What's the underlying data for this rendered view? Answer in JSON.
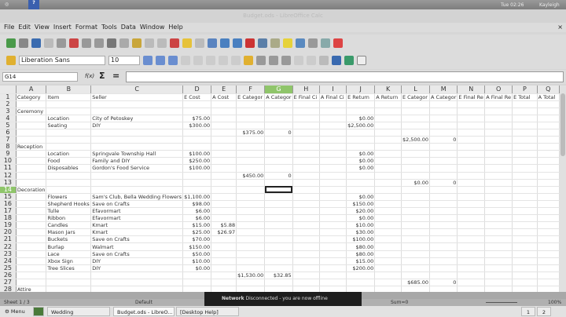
{
  "top_panel": {
    "clock": "Tue 02:26",
    "user": "Kayleigh"
  },
  "window": {
    "title": "Budget.ods - LibreOffice Calc"
  },
  "menu": [
    "File",
    "Edit",
    "View",
    "Insert",
    "Format",
    "Tools",
    "Data",
    "Window",
    "Help"
  ],
  "format_bar": {
    "font_name": "Liberation Sans",
    "font_size": "10"
  },
  "formula_bar": {
    "cell_ref": "G14",
    "fx": "f(x)",
    "sigma": "Σ",
    "equals": "=",
    "value": ""
  },
  "columns": [
    "A",
    "B",
    "C",
    "D",
    "E",
    "F",
    "G",
    "H",
    "I",
    "J",
    "K",
    "L",
    "M",
    "N",
    "O",
    "P",
    "Q"
  ],
  "selected_cell": "G14",
  "rows": [
    [
      "Category",
      "Item",
      "Seller",
      "E Cost",
      "A Cost",
      "E Categor",
      "A Categor",
      "E Final Ci",
      "A Final Ci",
      "E Return",
      "A Return",
      "E Categor",
      "A Categor",
      "E Final Re",
      "A Final Re",
      "E Total",
      "A Total"
    ],
    [],
    [
      "Ceremony"
    ],
    [
      "",
      "Location",
      "City of Petoskey",
      "$75.00",
      "",
      "",
      "",
      "",
      "",
      "$0.00"
    ],
    [
      "",
      "Seating",
      "DIY",
      "$300.00",
      "",
      "",
      "",
      "",
      "",
      "$2,500.00"
    ],
    [
      "",
      "",
      "",
      "",
      "",
      "$375.00",
      "0"
    ],
    [
      "",
      "",
      "",
      "",
      "",
      "",
      "",
      "",
      "",
      "",
      "",
      "$2,500.00",
      "0"
    ],
    [
      "Reception"
    ],
    [
      "",
      "Location",
      "Springvale Township Hall",
      "$100.00",
      "",
      "",
      "",
      "",
      "",
      "$0.00"
    ],
    [
      "",
      "Food",
      "Family and DIY",
      "$250.00",
      "",
      "",
      "",
      "",
      "",
      "$0.00"
    ],
    [
      "",
      "Disposables",
      "Gordon's Food Service",
      "$100.00",
      "",
      "",
      "",
      "",
      "",
      "$0.00"
    ],
    [
      "",
      "",
      "",
      "",
      "",
      "$450.00",
      "0"
    ],
    [
      "",
      "",
      "",
      "",
      "",
      "",
      "",
      "",
      "",
      "",
      "",
      "$0.00",
      "0"
    ],
    [
      "Decoration"
    ],
    [
      "",
      "Flowers",
      "Sam's Club, Bella Wedding Flowers",
      "$1,100.00",
      "",
      "",
      "",
      "",
      "",
      "$0.00"
    ],
    [
      "",
      "Shepherd Hooks",
      "Save on Crafts",
      "$98.00",
      "",
      "",
      "",
      "",
      "",
      "$150.00"
    ],
    [
      "",
      "Tulle",
      "Efavormart",
      "$6.00",
      "",
      "",
      "",
      "",
      "",
      "$20.00"
    ],
    [
      "",
      "Ribbon",
      "Efavormart",
      "$6.00",
      "",
      "",
      "",
      "",
      "",
      "$0.00"
    ],
    [
      "",
      "Candles",
      "Kmart",
      "$15.00",
      "$5.88",
      "",
      "",
      "",
      "",
      "$10.00"
    ],
    [
      "",
      "Mason Jars",
      "Kmart",
      "$25.00",
      "$26.97",
      "",
      "",
      "",
      "",
      "$30.00"
    ],
    [
      "",
      "Buckets",
      "Save on Crafts",
      "$70.00",
      "",
      "",
      "",
      "",
      "",
      "$100.00"
    ],
    [
      "",
      "Burlap",
      "Walmart",
      "$150.00",
      "",
      "",
      "",
      "",
      "",
      "$80.00"
    ],
    [
      "",
      "Lace",
      "Save on Crafts",
      "$50.00",
      "",
      "",
      "",
      "",
      "",
      "$80.00"
    ],
    [
      "",
      "Xbox Sign",
      "DIY",
      "$10.00",
      "",
      "",
      "",
      "",
      "",
      "$15.00"
    ],
    [
      "",
      "Tree Slices",
      "DIY",
      "$0.00",
      "",
      "",
      "",
      "",
      "",
      "$200.00"
    ],
    [
      "",
      "",
      "",
      "",
      "",
      "$1,530.00",
      "$32.85"
    ],
    [
      "",
      "",
      "",
      "",
      "",
      "",
      "",
      "",
      "",
      "",
      "",
      "$685.00",
      "0"
    ],
    [
      "Attire"
    ]
  ],
  "status": {
    "sheet": "Sheet 1 / 3",
    "style": "Default",
    "sum": "Sum=0",
    "zoom": "100%"
  },
  "notification": {
    "title": "Network",
    "message": "Disconnected - you are now offline"
  },
  "taskbar": {
    "menu": "Menu",
    "items": [
      "Wedding",
      "Budget.ods - LibreO...",
      "[Desktop Help]"
    ],
    "workspaces": [
      "1",
      "2"
    ]
  }
}
